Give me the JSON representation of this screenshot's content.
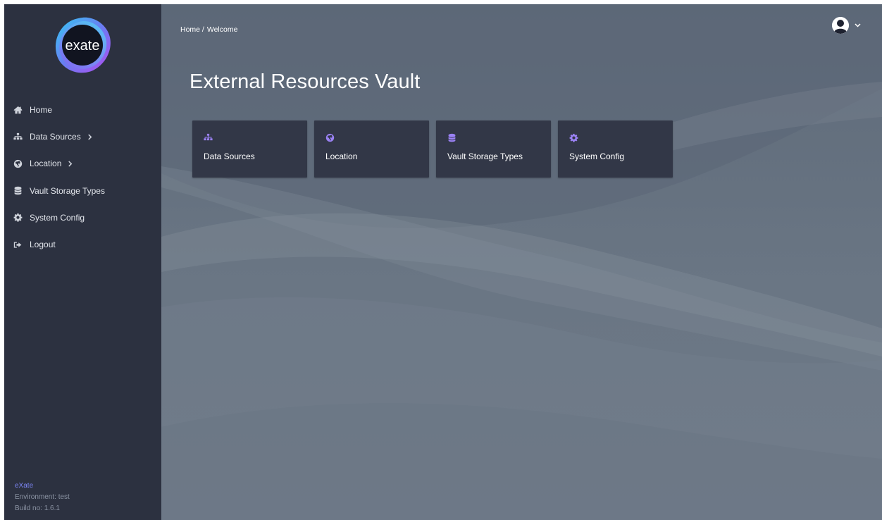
{
  "brand": {
    "logo_text": "exate"
  },
  "sidebar": {
    "items": [
      {
        "label": "Home",
        "icon": "home-icon",
        "has_submenu": false
      },
      {
        "label": "Data Sources",
        "icon": "sitemap-icon",
        "has_submenu": true
      },
      {
        "label": "Location",
        "icon": "globe-icon",
        "has_submenu": true
      },
      {
        "label": "Vault Storage Types",
        "icon": "database-icon",
        "has_submenu": false
      },
      {
        "label": "System Config",
        "icon": "gear-icon",
        "has_submenu": false
      },
      {
        "label": "Logout",
        "icon": "sign-out-icon",
        "has_submenu": false
      }
    ],
    "footer": {
      "brand": "eXate",
      "environment": "Environment: test",
      "build": "Build no: 1.6.1"
    }
  },
  "header": {
    "breadcrumb": {
      "home": "Home /",
      "current": "Welcome"
    },
    "user_menu_icon": "user-circle-icon"
  },
  "main": {
    "title": "External Resources Vault",
    "cards": [
      {
        "label": "Data Sources",
        "icon": "sitemap-icon"
      },
      {
        "label": "Location",
        "icon": "globe-icon"
      },
      {
        "label": "Vault Storage Types",
        "icon": "database-icon"
      },
      {
        "label": "System Config",
        "icon": "gear-icon"
      }
    ]
  },
  "colors": {
    "sidebar_bg": "#2c3140",
    "card_bg": "#323747",
    "accent": "#9b82f5",
    "footer_brand": "#7b84f2"
  }
}
